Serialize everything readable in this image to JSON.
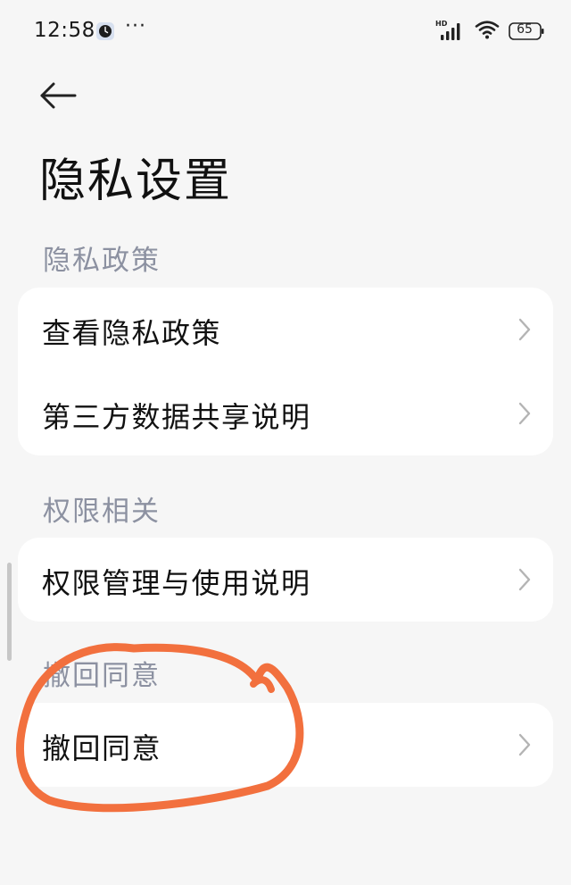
{
  "status_bar": {
    "time": "12:58",
    "more": "···",
    "network_badge": "HD",
    "battery_level": "65",
    "icons": [
      "clock-icon",
      "signal-icon",
      "wifi-icon",
      "battery-icon"
    ]
  },
  "header": {
    "back_icon": "back-arrow-icon",
    "title": "隐私设置"
  },
  "sections": [
    {
      "header": "隐私政策",
      "items": [
        {
          "label": "查看隐私政策",
          "icon": "chevron-right-icon"
        },
        {
          "label": "第三方数据共享说明",
          "icon": "chevron-right-icon"
        }
      ]
    },
    {
      "header": "权限相关",
      "items": [
        {
          "label": "权限管理与使用说明",
          "icon": "chevron-right-icon"
        }
      ]
    },
    {
      "header": "撤回同意",
      "items": [
        {
          "label": "撤回同意",
          "icon": "chevron-right-icon"
        }
      ]
    }
  ],
  "colors": {
    "background": "#f6f6f6",
    "card": "#ffffff",
    "section_header": "#8c91a1",
    "annotation": "#f2703e"
  }
}
